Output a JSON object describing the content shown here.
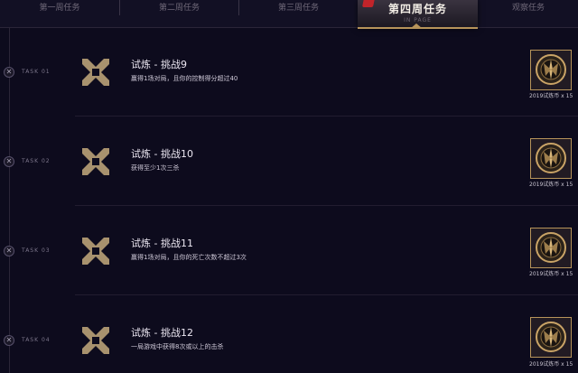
{
  "tabs": [
    {
      "label": "第一周任务"
    },
    {
      "label": "第二周任务"
    },
    {
      "label": "第三周任务"
    },
    {
      "label": "第四周任务",
      "sublabel": "IN PAGE",
      "active": true
    },
    {
      "label": "观察任务"
    }
  ],
  "tasks": [
    {
      "id": "TASK 01",
      "title": "试炼 - 挑战9",
      "desc": "赢得1场对局，且你的控制得分超过40",
      "reward": "2019试炼币 x 15",
      "node_icon": "x-icon"
    },
    {
      "id": "TASK 02",
      "title": "试炼 - 挑战10",
      "desc": "获得至少1次三杀",
      "reward": "2019试炼币 x 15",
      "node_icon": "x-icon"
    },
    {
      "id": "TASK 03",
      "title": "试炼 - 挑战11",
      "desc": "赢得1场对局，且你的死亡次数不超过3次",
      "reward": "2019试炼币 x 15",
      "node_icon": "x-icon"
    },
    {
      "id": "TASK 04",
      "title": "试炼 - 挑战12",
      "desc": "一局游戏中获得8次或以上的击杀",
      "reward": "2019试炼币 x 15",
      "node_icon": "x-icon"
    }
  ],
  "colors": {
    "accent_gold": "#b7945a",
    "background": "#0d0b1d",
    "badge_red": "#c1242a"
  }
}
